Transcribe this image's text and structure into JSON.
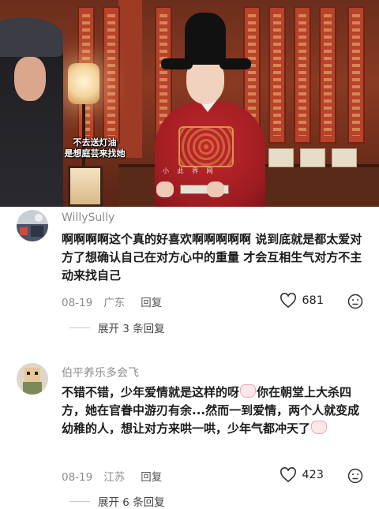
{
  "video": {
    "subtitle_line1": "不去送灯油",
    "subtitle_line2": "是想庭芸来找她",
    "watermark": "小 此 界 网"
  },
  "comments": [
    {
      "username": "WillySully",
      "text": "啊啊啊啊这个真的好喜欢啊啊啊啊啊 说到底就是都太爱对方了想确认自己在对方心中的重量 才会互相生气对方不主动来找自己",
      "date": "08-19",
      "location": "广东",
      "reply_label": "回复",
      "likes": "681",
      "expand_label": "展开 3 条回复"
    },
    {
      "username": "伯平养乐多会飞",
      "text_part1": "不错不错，少年爱情就是这样的呀",
      "text_part2": "你在朝堂上大杀四方，她在官眷中游刃有余...然而一到爱情，两个人就变成幼稚的人，想让对方来哄一哄，少年气都冲天了",
      "date": "08-19",
      "location": "江苏",
      "reply_label": "回复",
      "likes": "423",
      "expand_label": "展开 6 条回复"
    }
  ],
  "icons": {
    "like": "heart-outline-icon",
    "dislike": "dislike-face-icon",
    "emoji": "cat-emoji-icon"
  },
  "colors": {
    "username": "#8d8d8d",
    "meta": "#8a8a8a",
    "body": "#1b1b1b"
  }
}
